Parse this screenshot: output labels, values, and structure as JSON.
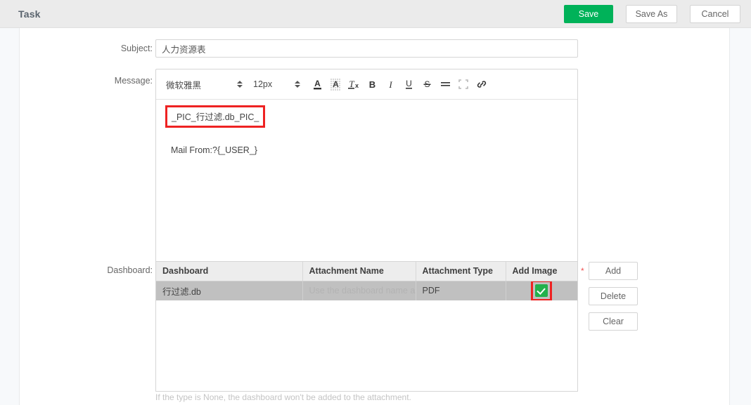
{
  "header": {
    "title": "Task",
    "save_label": "Save",
    "save_as_label": "Save As",
    "cancel_label": "Cancel",
    "accent_color": "#00b259"
  },
  "form": {
    "subject": {
      "label": "Subject:",
      "value": "人力资源表"
    },
    "message": {
      "label": "Message:",
      "toolbar": {
        "font_family": "微软雅黑",
        "font_size": "12px",
        "icons": [
          "font-color-icon",
          "highlight-color-icon",
          "clear-format-icon",
          "bold-icon",
          "italic-icon",
          "underline-icon",
          "strikethrough-icon",
          "align-icon",
          "fullscreen-icon",
          "link-icon"
        ]
      },
      "body": {
        "pic_token": "_PIC_行过滤.db_PIC_",
        "mail_from": "Mail From:?{_USER_}",
        "highlight_color": "#ee2222"
      }
    },
    "dashboard": {
      "label": "Dashboard:",
      "required_marker": "*",
      "columns": [
        "Dashboard",
        "Attachment Name",
        "Attachment Type",
        "Add Image"
      ],
      "rows": [
        {
          "dashboard": "行过滤.db",
          "attachment_name": "",
          "attachment_name_placeholder": "Use the dashboard name as",
          "attachment_type": "PDF",
          "add_image": true
        }
      ],
      "buttons": {
        "add": "Add",
        "delete": "Delete",
        "clear": "Clear"
      },
      "hint": "If the type is None, the dashboard won't be added to the attachment."
    }
  }
}
